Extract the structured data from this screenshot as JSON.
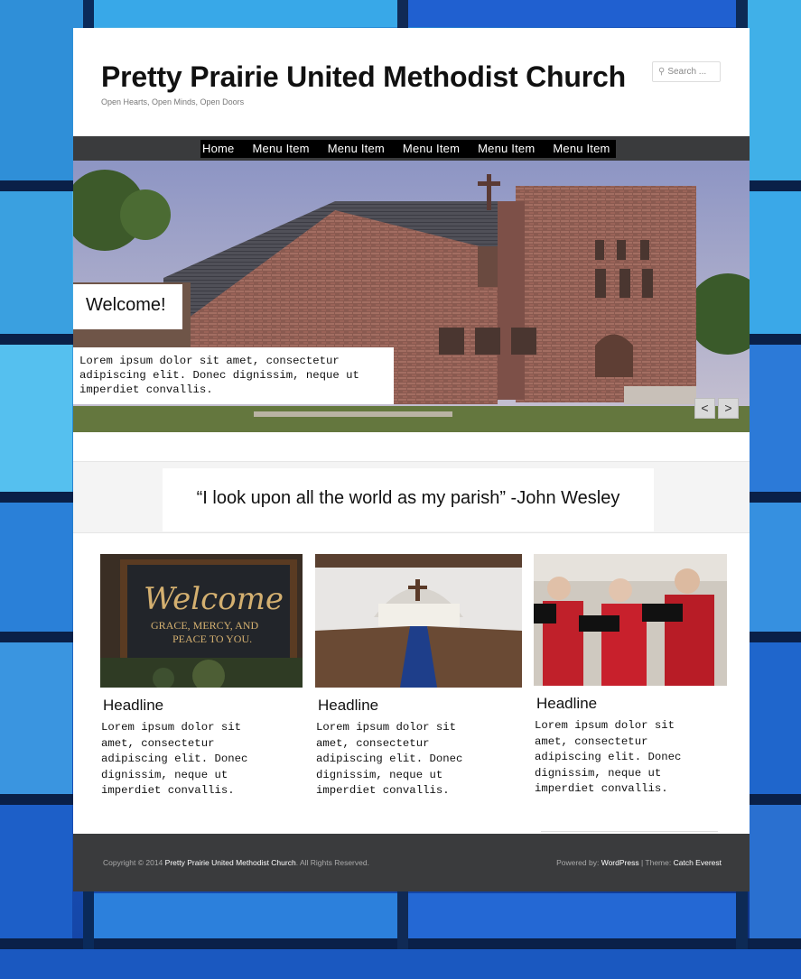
{
  "site": {
    "title": "Pretty Prairie United Methodist Church",
    "tagline": "Open Hearts, Open Minds, Open Doors"
  },
  "search": {
    "placeholder": "Search ...",
    "icon": "search-icon"
  },
  "nav": {
    "items": [
      {
        "label": "Home"
      },
      {
        "label": "Menu Item"
      },
      {
        "label": "Menu Item"
      },
      {
        "label": "Menu Item"
      },
      {
        "label": "Menu Item"
      },
      {
        "label": "Menu Item"
      }
    ]
  },
  "slider": {
    "heading": "Welcome!",
    "caption": "Lorem ipsum dolor sit amet, consectetur adipiscing elit. Donec dignissim, neque ut imperdiet convallis.",
    "prev_label": "<",
    "next_label": ">"
  },
  "quote": {
    "text": "“I look upon all the world as my parish” -John Wesley"
  },
  "features": [
    {
      "headline": "Headline",
      "body": "Lorem ipsum dolor sit amet, consectetur adipiscing elit. Donec dignissim, neque ut imperdiet convallis.",
      "image_text_1": "Welcome",
      "image_text_2": "GRACE, MERCY, AND",
      "image_text_3": "PEACE TO YOU."
    },
    {
      "headline": "Headline",
      "body": "Lorem ipsum dolor sit amet, consectetur adipiscing elit. Donec dignissim, neque ut imperdiet convallis."
    },
    {
      "headline": "Headline",
      "body": "Lorem ipsum dolor sit amet, consectetur adipiscing elit. Donec dignissim, neque ut imperdiet convallis."
    }
  ],
  "footer": {
    "copyright_prefix": "Copyright © 2014",
    "site_name": "Pretty Prairie United Methodist Church",
    "rights": ". All Rights Reserved.",
    "powered_by": "Powered by:",
    "wordpress": "WordPress",
    "separator": "|",
    "theme_label": "Theme:",
    "theme_name": "Catch Everest"
  },
  "colors": {
    "navbar": "#3a3b3d",
    "footer": "#3a3b3d",
    "background_glass": "#1b5fc0"
  }
}
